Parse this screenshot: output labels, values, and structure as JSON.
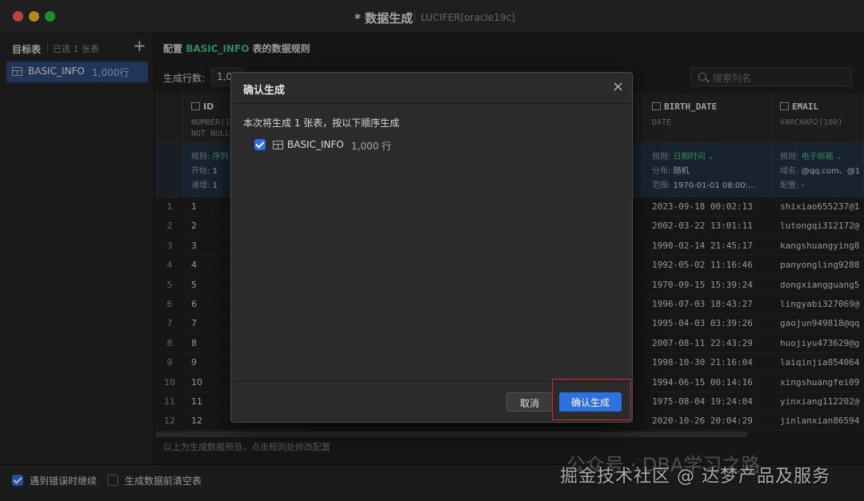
{
  "window": {
    "title": "* 数据生成",
    "subtitle": "LUCIFER[oracle19c]"
  },
  "sidebar": {
    "title": "目标表",
    "selected_count": "已选 1 张表",
    "add_label": "+",
    "items": [
      {
        "name": "BASIC_INFO",
        "rows": "1,000行"
      }
    ]
  },
  "main": {
    "config_prefix": "配置",
    "config_table": "BASIC_INFO",
    "config_suffix": "表的数据规则",
    "rows_label": "生成行数:",
    "rows_value": "1,0",
    "search_placeholder": "搜索列名",
    "footnote": "以上为生成数据预览，点击规则处修改配置"
  },
  "columns": [
    {
      "name": "ID",
      "type": "NUMBER(1",
      "nullable": "NOT NULL",
      "rule_label": "规则:",
      "rule_value": "序列",
      "line2_label": "开始:",
      "line2_value": "1",
      "line3_label": "递增:",
      "line3_value": "1"
    },
    {
      "name": "BIRTH_DATE",
      "type": "DATE",
      "nullable": "",
      "rule_label": "规则:",
      "rule_value": "日期时间",
      "line2_label": "分布:",
      "line2_value": "随机",
      "line3_label": "范围:",
      "line3_value": "1970-01-01 08:00:..."
    },
    {
      "name": "EMAIL",
      "type": "VARCHAR2(100)",
      "nullable": "",
      "rule_label": "规则:",
      "rule_value": "电子邮箱",
      "line2_label": "域名:",
      "line2_value": "@qq.com、@1",
      "line3_label": "配置:",
      "line3_value": "-"
    }
  ],
  "rows": [
    {
      "n": "1",
      "id": "1",
      "birth": "2023-09-18 00:02:13",
      "email": "shixiao655237@1"
    },
    {
      "n": "2",
      "id": "2",
      "birth": "2002-03-22 13:01:11",
      "email": "lutongqi312172@"
    },
    {
      "n": "3",
      "id": "3",
      "birth": "1990-02-14 21:45:17",
      "email": "kangshuangying8"
    },
    {
      "n": "4",
      "id": "4",
      "birth": "1992-05-02 11:16:46",
      "email": "panyongling9288"
    },
    {
      "n": "5",
      "id": "5",
      "birth": "1970-09-15 15:39:24",
      "email": "dongxiangguang5"
    },
    {
      "n": "6",
      "id": "6",
      "birth": "1996-07-03 18:43:27",
      "email": "lingyabi327069@"
    },
    {
      "n": "7",
      "id": "7",
      "birth": "1995-04-03 03:39:26",
      "email": "gaojun949818@qq"
    },
    {
      "n": "8",
      "id": "8",
      "birth": "2007-08-11 22:43:29",
      "email": "huojiyu473629@g"
    },
    {
      "n": "9",
      "id": "9",
      "birth": "1998-10-30 21:16:04",
      "email": "laiqinjia854064"
    },
    {
      "n": "10",
      "id": "10",
      "birth": "1994-06-15 00:14:16",
      "email": "xingshuangfei09"
    },
    {
      "n": "11",
      "id": "11",
      "birth": "1975-08-04 19:24:04",
      "email": "yinxiang112202@"
    },
    {
      "n": "12",
      "id": "12",
      "birth": "2020-10-26 20:04:29",
      "email": "jinlanxian86594"
    }
  ],
  "bottom": {
    "continue_on_error": "遇到错误时继续",
    "clear_before": "生成数据前清空表"
  },
  "watermark": {
    "faint": "公众号 · DBA学习之路",
    "main": "掘金技术社区 @ 达梦产品及服务"
  },
  "modal": {
    "title": "确认生成",
    "close": "×",
    "description": "本次将生成 1 张表，按以下顺序生成",
    "item_name": "BASIC_INFO",
    "item_rows": "1,000 行",
    "cancel": "取消",
    "confirm": "确认生成"
  },
  "colors": {
    "accent": "#2f6fe0",
    "table_name": "#3fbf7f",
    "highlight": "#d92b2b"
  }
}
